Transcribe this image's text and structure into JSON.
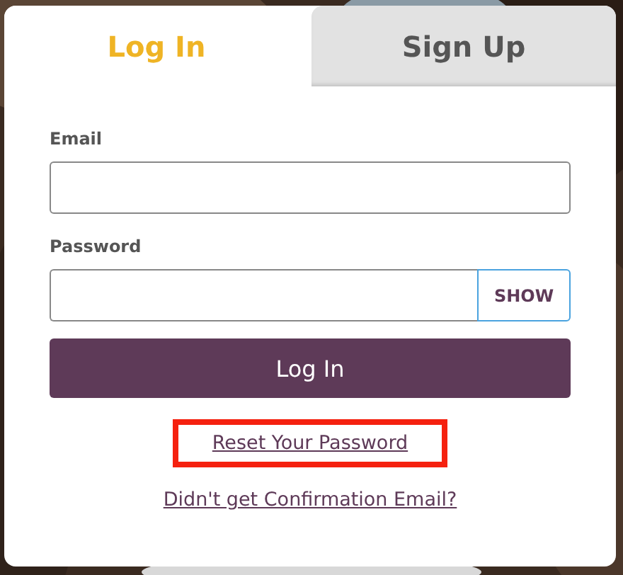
{
  "tabs": [
    {
      "label": "Log In",
      "selected": true
    },
    {
      "label": "Sign Up",
      "selected": false
    }
  ],
  "fields": [
    {
      "label": "Email",
      "kind": "text"
    },
    {
      "label": "Password",
      "kind": "password",
      "toggle": "SHOW"
    }
  ],
  "submit": "Log In",
  "links": [
    {
      "label": "Reset Your Password",
      "highlighted": true
    },
    {
      "label": "Didn't get Confirmation Email?",
      "highlighted": false
    }
  ]
}
